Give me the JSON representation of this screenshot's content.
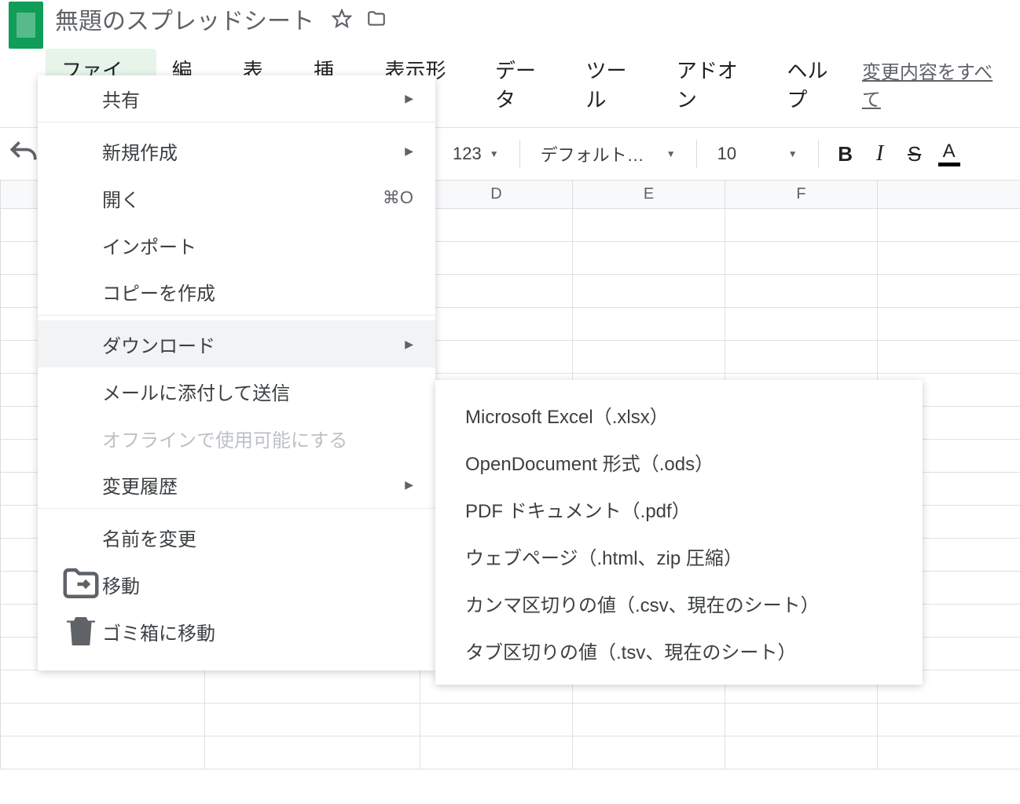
{
  "header": {
    "title": "無題のスプレッドシート"
  },
  "menubar": {
    "items": [
      "ファイル",
      "編集",
      "表示",
      "挿入",
      "表示形式",
      "データ",
      "ツール",
      "アドオン",
      "ヘルプ"
    ],
    "right_link": "変更内容をすべて"
  },
  "toolbar": {
    "number_format": "123",
    "font": "デフォルト…",
    "font_size": "10",
    "bold": "B",
    "italic": "I",
    "strike": "S",
    "textcolor": "A"
  },
  "columns": [
    "",
    "",
    "D",
    "E",
    "F",
    ""
  ],
  "file_menu": {
    "items": [
      {
        "label": "共有",
        "icon": null,
        "submenu": false,
        "shortcut": "",
        "sep_after": true
      },
      {
        "label": "新規作成",
        "icon": null,
        "submenu": true,
        "shortcut": ""
      },
      {
        "label": "開く",
        "icon": null,
        "submenu": false,
        "shortcut": "⌘O"
      },
      {
        "label": "インポート",
        "icon": null,
        "submenu": false,
        "shortcut": ""
      },
      {
        "label": "コピーを作成",
        "icon": null,
        "submenu": false,
        "shortcut": "",
        "sep_after": true
      },
      {
        "label": "ダウンロード",
        "icon": null,
        "submenu": true,
        "shortcut": "",
        "highlighted": true
      },
      {
        "label": "メールに添付して送信",
        "icon": null,
        "submenu": false,
        "shortcut": ""
      },
      {
        "label": "オフラインで使用可能にする",
        "icon": null,
        "submenu": false,
        "shortcut": "",
        "disabled": true
      },
      {
        "label": "変更履歴",
        "icon": null,
        "submenu": true,
        "shortcut": "",
        "sep_after": true
      },
      {
        "label": "名前を変更",
        "icon": null,
        "submenu": false,
        "shortcut": ""
      },
      {
        "label": "移動",
        "icon": "move",
        "submenu": false,
        "shortcut": ""
      },
      {
        "label": "ゴミ箱に移動",
        "icon": "trash",
        "submenu": false,
        "shortcut": ""
      }
    ]
  },
  "download_submenu": {
    "items": [
      "Microsoft Excel（.xlsx）",
      "OpenDocument 形式（.ods）",
      "PDF ドキュメント（.pdf）",
      "ウェブページ（.html、zip 圧縮）",
      "カンマ区切りの値（.csv、現在のシート）",
      "タブ区切りの値（.tsv、現在のシート）"
    ]
  }
}
